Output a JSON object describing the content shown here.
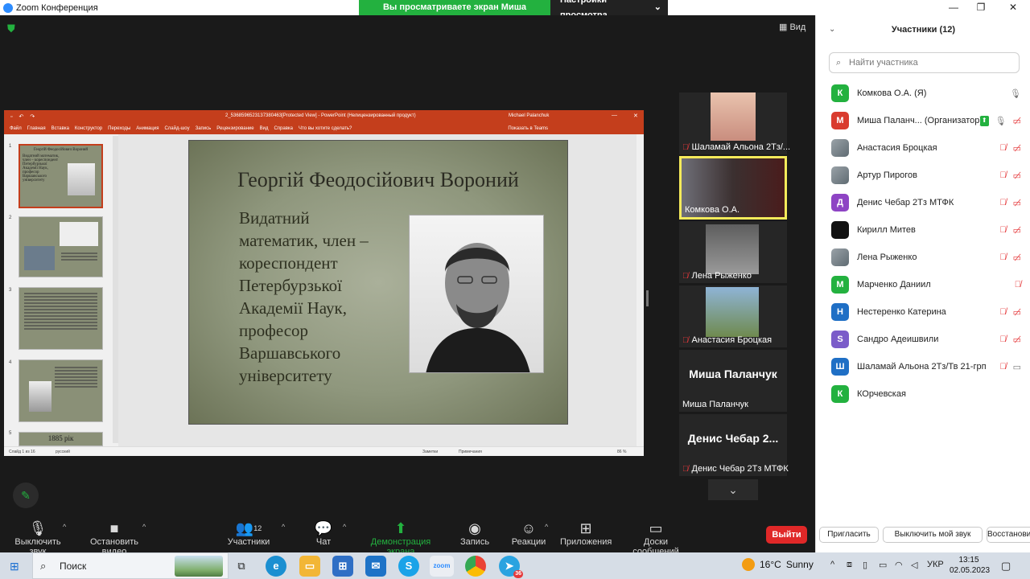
{
  "window": {
    "title": "Zoom Конференция",
    "share_banner": "Вы просматриваете экран Миша Паланчук",
    "view_options": "Настройки просмотра",
    "view_button": "Вид"
  },
  "ppt": {
    "doc_title": "2_5368596523137380463[Protected View] - PowerPoint (Нелицензированный продукт)",
    "user": "Michael Palanchuk",
    "menu": [
      "Файл",
      "Главная",
      "Вставка",
      "Конструктор",
      "Переходы",
      "Анимация",
      "Слайд-шоу",
      "Запись",
      "Рецензирование",
      "Вид",
      "Справка",
      "Что вы хотите сделать?"
    ],
    "share_label": "Показать в Teams",
    "thumbnails": [
      {
        "num": "1",
        "title": "Георгій Феодосійович Вороний",
        "text": "Видатний математик, член – кореспондент Петербурзької Академії Наук, професор Варшавського університету"
      },
      {
        "num": "2"
      },
      {
        "num": "3"
      },
      {
        "num": "4"
      },
      {
        "num": "5",
        "title": "1885 рік"
      }
    ],
    "slide": {
      "title": "Георгій Феодосійович Вороний",
      "lines": [
        "Видатний",
        "математик, член –",
        "кореспондент",
        "Петербурзької",
        "Академії Наук,",
        "професор",
        "Варшавського",
        "університету"
      ]
    },
    "status": {
      "slide_of": "Слайд 1 из 16",
      "lang": "русский",
      "notes": "Заметки",
      "comments": "Примечания",
      "zoom": "86 %"
    }
  },
  "gallery": [
    {
      "name": "Шаламай Альона 2Тз/...",
      "muted": true,
      "video": true
    },
    {
      "name": "Комкова О.А.",
      "muted": false,
      "video": true,
      "active": true
    },
    {
      "name": "Лена Рыженко",
      "muted": true,
      "video": true
    },
    {
      "name": "Анастасия Броцкая",
      "muted": true,
      "video": true
    },
    {
      "name": "Миша Паланчук",
      "big": "Миша Паланчук",
      "muted": false,
      "video": false
    },
    {
      "name": "Денис Чебар 2Тз МТФК",
      "big": "Денис Чебар 2...",
      "muted": true,
      "video": false
    }
  ],
  "toolbar": {
    "mute": "Выключить звук",
    "video": "Остановить видео",
    "participants": "Участники",
    "participants_count": "12",
    "chat": "Чат",
    "share": "Демонстрация экрана",
    "record": "Запись",
    "reactions": "Реакции",
    "apps": "Приложения",
    "whiteboards": "Доски сообщений",
    "leave": "Выйти"
  },
  "panel": {
    "title": "Участники (12)",
    "search_placeholder": "Найти участника",
    "participants": [
      {
        "initial": "К",
        "color": "#23b13f",
        "name": "Комкова О.А. (Я)",
        "mic": "on",
        "cam": "none"
      },
      {
        "initial": "М",
        "color": "#d93b2e",
        "name": "Миша Паланч... (Организатор)",
        "mic": "on",
        "cam": "off",
        "sharing": true
      },
      {
        "initial": "",
        "photo": true,
        "name": "Анастасия Броцкая",
        "mic": "off",
        "cam": "off"
      },
      {
        "initial": "",
        "photo": true,
        "name": "Артур Пирогов",
        "mic": "off",
        "cam": "off"
      },
      {
        "initial": "Д",
        "color": "#8e44c4",
        "name": "Денис Чебар 2Тз МТФК",
        "mic": "off",
        "cam": "off"
      },
      {
        "initial": "",
        "color": "#111111",
        "name": "Кирилл Митев",
        "mic": "off",
        "cam": "off"
      },
      {
        "initial": "",
        "photo": true,
        "name": "Лена Рыженко",
        "mic": "off",
        "cam": "off"
      },
      {
        "initial": "М",
        "color": "#23b13f",
        "name": "Марченко Даниил",
        "mic": "off",
        "cam": "none"
      },
      {
        "initial": "Н",
        "color": "#1f6fc5",
        "name": "Нестеренко Катерина",
        "mic": "off",
        "cam": "off"
      },
      {
        "initial": "S",
        "color": "#7b5cc9",
        "name": "Сандро Адеишвили",
        "mic": "off",
        "cam": "off"
      },
      {
        "initial": "Ш",
        "color": "#1f6fc5",
        "name": "Шаламай Альона 2Тз/Тв 21-грп",
        "mic": "off",
        "cam": "on"
      },
      {
        "initial": "К",
        "color": "#23b13f",
        "name": "КОрчевская",
        "mic": "none",
        "cam": "none"
      }
    ],
    "invite": "Пригласить",
    "mute_me": "Выключить мой звук",
    "restore": "Восстановить"
  },
  "taskbar": {
    "search": "Поиск",
    "temp": "16°C",
    "weather": "Sunny",
    "lang": "УКР",
    "time": "13:15",
    "date": "02.05.2023",
    "telegram_badge": "36",
    "zoom_label": "zoom"
  }
}
